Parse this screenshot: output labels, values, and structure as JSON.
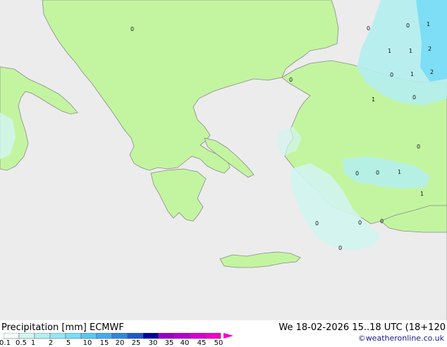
{
  "map": {
    "colors": {
      "sea": "#ececec",
      "land": "#c3f5a0",
      "coast": "#8a8a8a"
    },
    "point_values": [
      "0",
      "1",
      "1",
      "1",
      "2",
      "0",
      "0",
      "1",
      "2",
      "0",
      "0",
      "0",
      "1",
      "0",
      "0",
      "0",
      "1",
      "1",
      "0",
      "0",
      "0",
      "0"
    ]
  },
  "footer": {
    "title": "Precipitation [mm]  ECMWF",
    "valid_time": "We 18-02-2026 15..18 UTC (18+120",
    "credit": "©weatheronline.co.uk",
    "legend": {
      "labels": [
        "0.1",
        "0.5",
        "1",
        "2",
        "5",
        "10",
        "15",
        "20",
        "25",
        "30",
        "35",
        "40",
        "45",
        "50"
      ],
      "colors": [
        "#f5fffa",
        "#d2f5f0",
        "#b4eef0",
        "#96e6f5",
        "#78dcf5",
        "#5ac8f0",
        "#46aaf0",
        "#3287dc",
        "#1e5ac8",
        "#0000a0",
        "#9600c8",
        "#b400d2",
        "#d200d2",
        "#f000c8"
      ]
    }
  }
}
